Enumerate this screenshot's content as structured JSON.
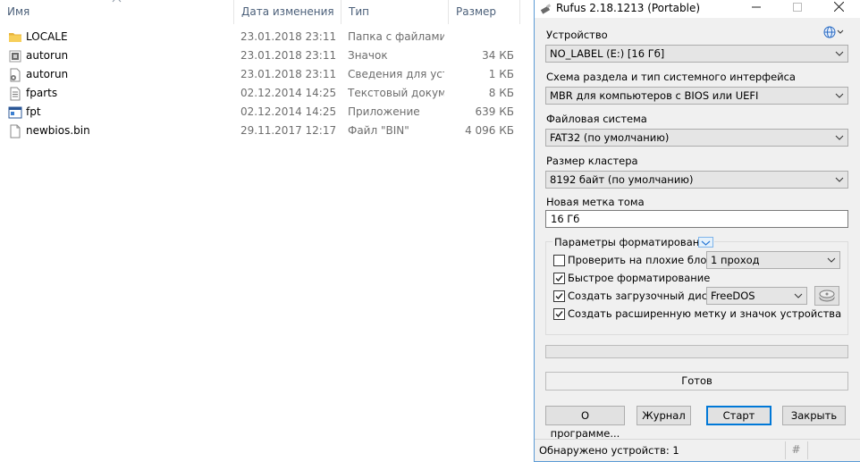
{
  "explorer": {
    "columns": {
      "name": "Имя",
      "date": "Дата изменения",
      "type": "Тип",
      "size": "Размер"
    },
    "files": [
      {
        "name": "LOCALE",
        "date": "23.01.2018 23:11",
        "type": "Папка с файлами",
        "size": "",
        "icon": "folder-icon"
      },
      {
        "name": "autorun",
        "date": "23.01.2018 23:11",
        "type": "Значок",
        "size": "34 КБ",
        "icon": "icon-file-icon"
      },
      {
        "name": "autorun",
        "date": "23.01.2018 23:11",
        "type": "Сведения для уст...",
        "size": "1 КБ",
        "icon": "settings-file-icon"
      },
      {
        "name": "fparts",
        "date": "02.12.2014 14:25",
        "type": "Текстовый докум...",
        "size": "8 КБ",
        "icon": "text-file-icon"
      },
      {
        "name": "fpt",
        "date": "02.12.2014 14:25",
        "type": "Приложение",
        "size": "639 КБ",
        "icon": "application-icon"
      },
      {
        "name": "newbios.bin",
        "date": "29.11.2017 12:17",
        "type": "Файл \"BIN\"",
        "size": "4 096 КБ",
        "icon": "generic-file-icon"
      }
    ]
  },
  "rufus": {
    "title": "Rufus 2.18.1213 (Portable)",
    "device_label": "Устройство",
    "device_value": "NO_LABEL (E:) [16 Гб]",
    "partition_label": "Схема раздела и тип системного интерфейса",
    "partition_value": "MBR для компьютеров с BIOS или UEFI",
    "fs_label": "Файловая система",
    "fs_value": "FAT32 (по умолчанию)",
    "cluster_label": "Размер кластера",
    "cluster_value": "8192 байт (по умолчанию)",
    "volume_label": "Новая метка тома",
    "volume_value": "16 Гб",
    "format_options_label": "Параметры форматирования",
    "check_bad_blocks_label": "Проверить на плохие блоки",
    "check_bad_blocks_checked": false,
    "passes_value": "1 проход",
    "quick_format_label": "Быстрое форматирование",
    "quick_format_checked": true,
    "bootable_label": "Создать загрузочный диск",
    "bootable_checked": true,
    "boot_type_value": "FreeDOS",
    "extended_label_label": "Создать расширенную метку и значок устройства",
    "extended_label_checked": true,
    "status_text": "Готов",
    "btn_about": "О программе...",
    "btn_log": "Журнал",
    "btn_start": "Старт",
    "btn_close": "Закрыть",
    "statusbar_text": "Обнаружено устройств: 1",
    "statusbar_hash": "#"
  }
}
